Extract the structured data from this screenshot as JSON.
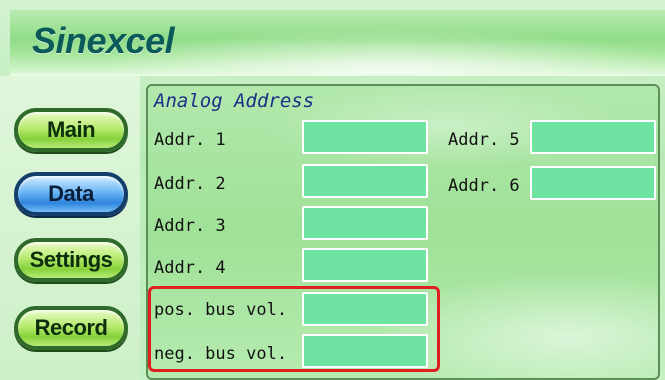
{
  "header": {
    "brand": "Sinexcel"
  },
  "nav": {
    "items": [
      {
        "label": "Main",
        "active": false
      },
      {
        "label": "Data",
        "active": true
      },
      {
        "label": "Settings",
        "active": false
      },
      {
        "label": "Record",
        "active": false
      }
    ]
  },
  "panel": {
    "title": "Analog Address",
    "left_fields": [
      {
        "label": "Addr. 1",
        "value": ""
      },
      {
        "label": "Addr. 2",
        "value": ""
      },
      {
        "label": "Addr. 3",
        "value": ""
      },
      {
        "label": "Addr. 4",
        "value": ""
      },
      {
        "label": "pos. bus vol.",
        "value": ""
      },
      {
        "label": "neg. bus vol.",
        "value": ""
      }
    ],
    "right_fields": [
      {
        "label": "Addr. 5",
        "value": ""
      },
      {
        "label": "Addr. 6",
        "value": ""
      }
    ]
  },
  "colors": {
    "active_nav": "#2f86de",
    "nav": "#86d13a",
    "field_fill": "#6ee3a2",
    "highlight_border": "#e02020",
    "title_text": "#1c2f86",
    "brand_text": "#0b5a5a"
  }
}
